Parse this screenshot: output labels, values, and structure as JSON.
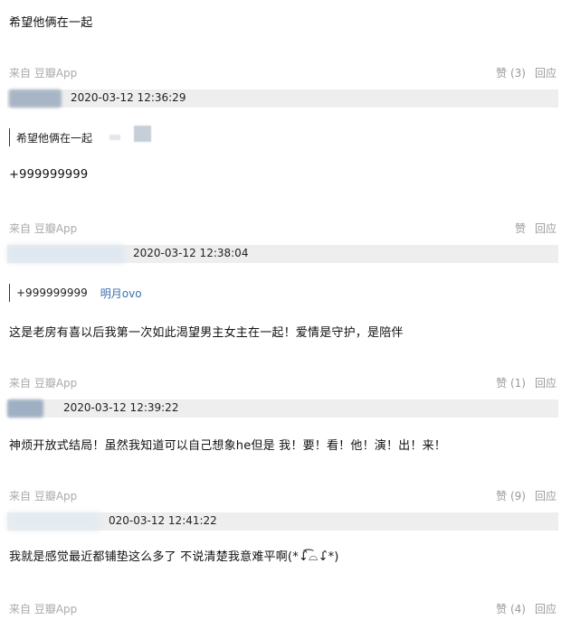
{
  "comments": [
    {
      "text": "希望他俩在一起",
      "source": "来自 豆瓣App",
      "like_label": "赞 (3)",
      "reply_label": "回应"
    },
    {
      "timestamp": "2020-03-12 12:36:29",
      "quote_text": "希望他俩在一起",
      "text": "+999999999",
      "source": "来自 豆瓣App",
      "like_label": "赞",
      "reply_label": "回应"
    },
    {
      "timestamp": "2020-03-12 12:38:04",
      "quote_text": "+999999999",
      "quote_author": "明月ovo",
      "text": "这是老房有喜以后我第一次如此渴望男主女主在一起！爱情是守护，是陪伴",
      "source": "来自 豆瓣App",
      "like_label": "赞 (1)",
      "reply_label": "回应"
    },
    {
      "timestamp": "2020-03-12 12:39:22",
      "text": "神烦开放式结局！虽然我知道可以自己想象he但是 我！要！看！他！演！出！来！",
      "source": "来自 豆瓣App",
      "like_label": "赞 (9)",
      "reply_label": "回应"
    },
    {
      "timestamp": "020-03-12 12:41:22",
      "text": "我就是感觉最近都铺垫这么多了 不说清楚我意难平啊(*↓̂͡⌓↓̂*)",
      "source": "来自 豆瓣App",
      "like_label": "赞 (4)",
      "reply_label": "回应"
    }
  ]
}
